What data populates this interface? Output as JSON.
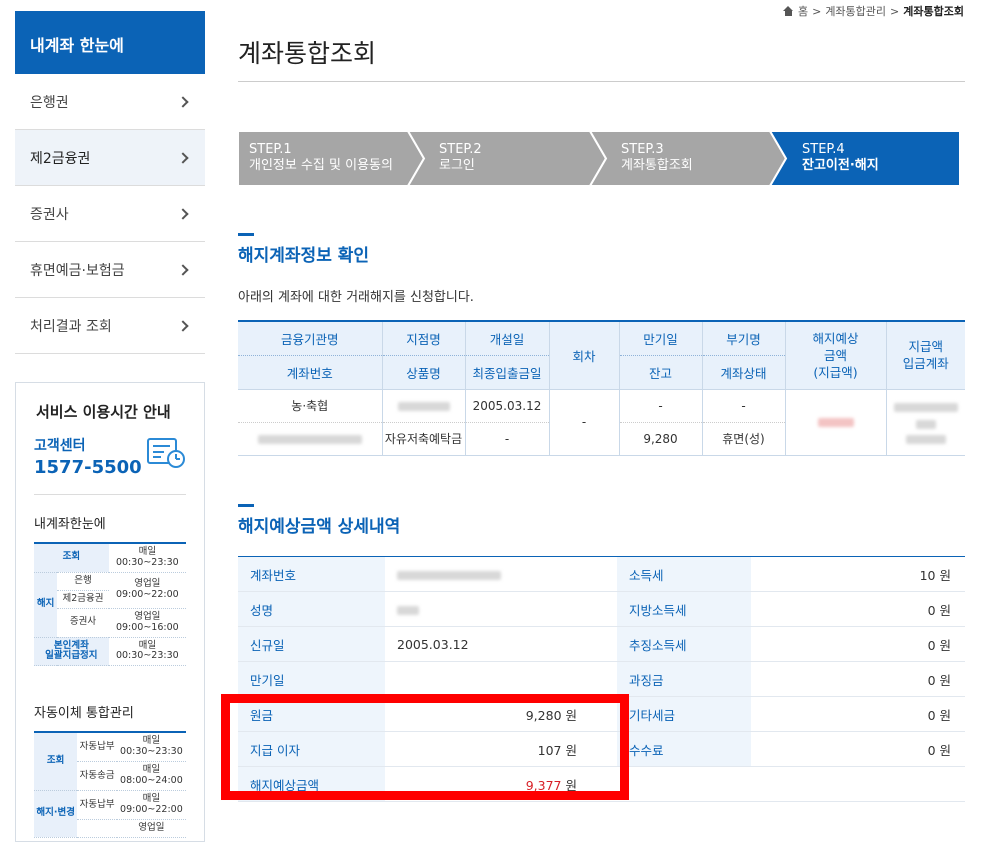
{
  "sidebar": {
    "title": "내계좌 한눈에",
    "items": [
      {
        "label": "은행권"
      },
      {
        "label": "제2금융권"
      },
      {
        "label": "증권사"
      },
      {
        "label": "휴면예금·보험금"
      },
      {
        "label": "처리결과 조회"
      }
    ],
    "service": {
      "title": "서비스 이용시간 안내",
      "center_label": "고객센터",
      "center_number": "1577-5500",
      "sections": [
        {
          "title": "내계좌한눈에",
          "rows": [
            [
              "조회",
              "",
              "매일",
              "00:30~23:30"
            ],
            [
              "해지",
              "은행",
              "영업일",
              "09:00~22:00"
            ],
            [
              "",
              "제2금융권",
              "",
              ""
            ],
            [
              "",
              "증권사",
              "영업일",
              "09:00~16:00"
            ],
            [
              "본인계좌",
              "일괄지급정지",
              "매일",
              "00:30~23:30"
            ]
          ]
        },
        {
          "title": "자동이체 통합관리",
          "rows": [
            [
              "조회",
              "자동납부",
              "매일",
              "00:30~23:30"
            ],
            [
              "",
              "자동송금",
              "매일",
              "08:00~24:00"
            ],
            [
              "해지·변경",
              "자동납부",
              "매일",
              "09:00~22:00"
            ],
            [
              "",
              "",
              "영업일",
              ""
            ]
          ]
        }
      ]
    }
  },
  "breadcrumb": {
    "home": "홈",
    "level1": "계좌통합관리",
    "current": "계좌통합조회"
  },
  "page_title": "계좌통합조회",
  "steps": [
    {
      "num": "STEP.1",
      "label": "개인정보 수집 및 이용동의"
    },
    {
      "num": "STEP.2",
      "label": "로그인"
    },
    {
      "num": "STEP.3",
      "label": "계좌통합조회"
    },
    {
      "num": "STEP.4",
      "label": "잔고이전·해지"
    }
  ],
  "section1": {
    "title": "해지계좌정보 확인",
    "desc": "아래의 계좌에 대한 거래해지를 신청합니다.",
    "headers": {
      "inst": "금융기관명",
      "acct": "계좌번호",
      "branch": "지점명",
      "product": "상품명",
      "open": "개설일",
      "last": "최종입출금일",
      "round": "회차",
      "mat": "만기일",
      "bal": "잔고",
      "sub": "부기명",
      "state": "계좌상태",
      "exp1": "해지예상",
      "exp2": "금액",
      "exp3": "(지급액)",
      "pay1": "지급액",
      "pay2": "입금계좌"
    },
    "row": {
      "inst": "농·축협",
      "open": "2005.03.12",
      "round": "-",
      "mat": "-",
      "sub": "-",
      "product": "자유저축예탁금",
      "last": "-",
      "bal": "9,280",
      "state": "휴면(성)"
    }
  },
  "section2": {
    "title": "해지예상금액 상세내역",
    "left": [
      {
        "k": "계좌번호",
        "v": ""
      },
      {
        "k": "성명",
        "v": ""
      },
      {
        "k": "신규일",
        "v": "2005.03.12"
      },
      {
        "k": "만기일",
        "v": ""
      },
      {
        "k": "원금",
        "v": "9,280 원"
      },
      {
        "k": "지급 이자",
        "v": "107 원"
      },
      {
        "k": "해지예상금액",
        "v": "9,377",
        "unit": "원"
      }
    ],
    "right": [
      {
        "k": "소득세",
        "v": "10 원"
      },
      {
        "k": "지방소득세",
        "v": "0 원"
      },
      {
        "k": "추징소득세",
        "v": "0 원"
      },
      {
        "k": "과징금",
        "v": "0 원"
      },
      {
        "k": "기타세금",
        "v": "0 원"
      },
      {
        "k": "수수료",
        "v": "0 원"
      },
      {
        "k": "",
        "v": ""
      }
    ]
  },
  "colors": {
    "accent": "#0b63b6",
    "highlight": "#ff0000",
    "amount": "#d81f26"
  }
}
